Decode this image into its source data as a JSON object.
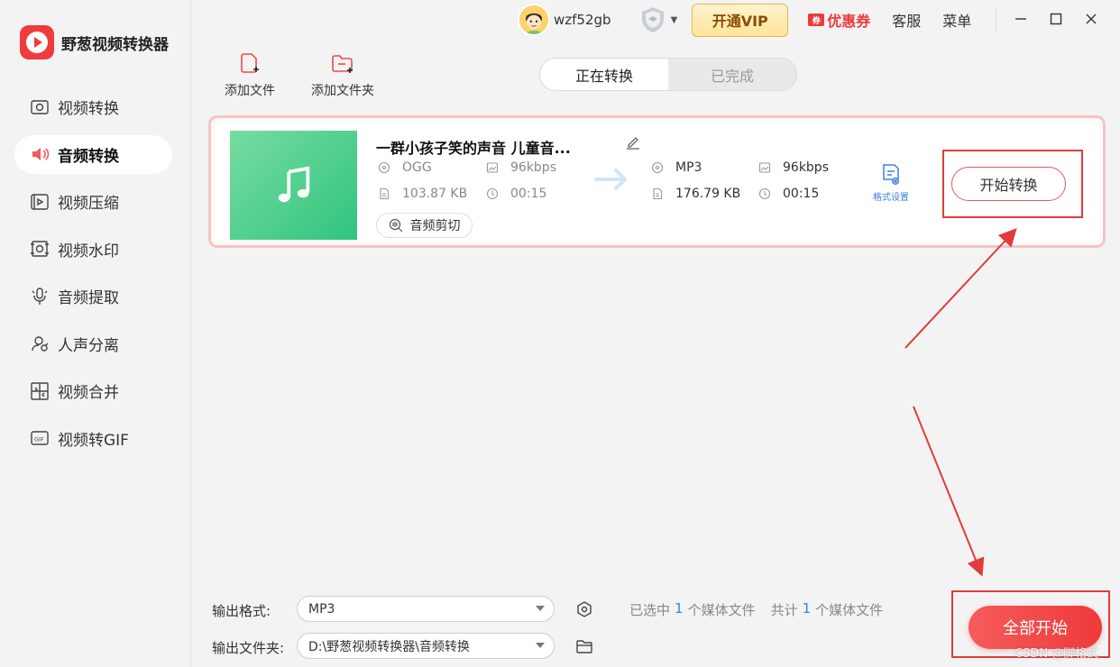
{
  "app": {
    "title": "野葱视频转换器"
  },
  "sidebar": {
    "items": [
      {
        "label": "视频转换",
        "icon": "video-convert-icon",
        "active": false
      },
      {
        "label": "音频转换",
        "icon": "audio-convert-icon",
        "active": true
      },
      {
        "label": "视频压缩",
        "icon": "video-compress-icon",
        "active": false
      },
      {
        "label": "视频水印",
        "icon": "video-watermark-icon",
        "active": false
      },
      {
        "label": "音频提取",
        "icon": "audio-extract-icon",
        "active": false
      },
      {
        "label": "人声分离",
        "icon": "vocal-separate-icon",
        "active": false
      },
      {
        "label": "视频合并",
        "icon": "video-merge-icon",
        "active": false
      },
      {
        "label": "视频转GIF",
        "icon": "video-gif-icon",
        "active": false
      }
    ]
  },
  "topbar": {
    "username": "wzf52gb",
    "vip_label": "开通VIP",
    "coupon_tag": "券",
    "coupon_label": "优惠券",
    "service_label": "客服",
    "menu_label": "菜单"
  },
  "toolbar": {
    "add_file_label": "添加文件",
    "add_folder_label": "添加文件夹"
  },
  "tabs": [
    {
      "label": "正在转换",
      "active": true
    },
    {
      "label": "已完成",
      "active": false
    }
  ],
  "file": {
    "title": "一群小孩子笑的声音 儿童音...",
    "source": {
      "format": "OGG",
      "bitrate": "96kbps",
      "size": "103.87 KB",
      "duration": "00:15"
    },
    "target": {
      "format": "MP3",
      "bitrate": "96kbps",
      "size": "176.79 KB",
      "duration": "00:15"
    },
    "clip_label": "音频剪切",
    "format_settings_label": "格式设置",
    "start_label": "开始转换"
  },
  "output": {
    "format_label": "输出格式:",
    "format_value": "MP3",
    "folder_label": "输出文件夹:",
    "folder_value": "D:\\野葱视频转换器\\音频转换"
  },
  "stats": {
    "selected_prefix": "已选中",
    "selected_count": "1",
    "selected_suffix": "个媒体文件",
    "total_prefix": "共计",
    "total_count": "1",
    "total_suffix": "个媒体文件"
  },
  "all_start_label": "全部开始",
  "watermark": "CSDN @脚格式",
  "colors": {
    "brand_red": "#ef3b3b",
    "annotation_red": "#e23b3b",
    "accent_blue": "#3d7fe0",
    "thumb_green": "#31c47e"
  }
}
